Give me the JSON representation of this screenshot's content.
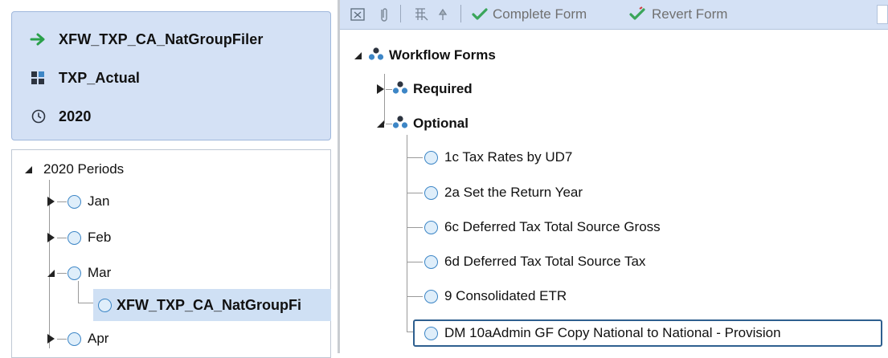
{
  "pov": {
    "workflow": "XFW_TXP_CA_NatGroupFiler",
    "scenario": "TXP_Actual",
    "time": "2020",
    "icons": [
      "arrow-right-icon",
      "cube-icon",
      "clock-icon"
    ]
  },
  "periods": {
    "root": "2020 Periods",
    "items": [
      {
        "label": "Jan",
        "state": "collapsed"
      },
      {
        "label": "Feb",
        "state": "collapsed"
      },
      {
        "label": "Mar",
        "state": "expanded"
      },
      {
        "label": "XFW_TXP_CA_NatGroupFi",
        "state": "selected-child"
      },
      {
        "label": "Apr",
        "state": "collapsed"
      }
    ]
  },
  "toolbar": {
    "complete_label": "Complete Form",
    "revert_label": "Revert Form"
  },
  "forms": {
    "root": "Workflow Forms",
    "required": "Required",
    "optional": "Optional",
    "items": [
      "1c Tax Rates by UD7",
      "2a Set the Return Year",
      "6c Deferred Tax Total Source Gross",
      "6d Deferred Tax Total Source Tax",
      "9 Consolidated ETR",
      "DM 10aAdmin GF Copy National to National - Provision"
    ]
  },
  "colors": {
    "panel_bg": "#d4e1f5",
    "node_circle": "#3d86c6",
    "check_green": "#3aa55a",
    "selection_border": "#2e5f8f",
    "selection_bg": "#cfe0f4"
  }
}
